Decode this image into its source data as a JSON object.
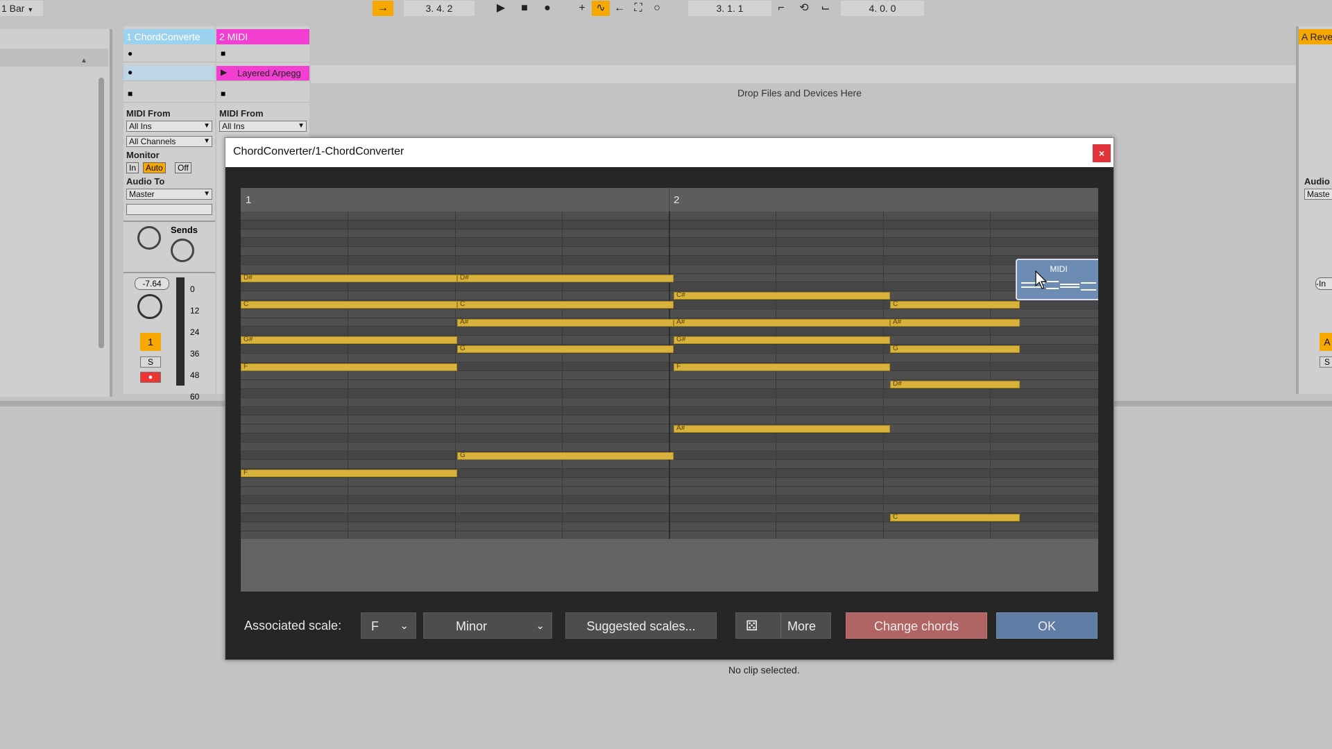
{
  "topbar": {
    "quantize": "1 Bar",
    "position": "3.  4.  2",
    "loop_start": "3.  1.  1",
    "loop_length": "4.  0.  0"
  },
  "tracks": [
    {
      "name": "1 ChordConverte",
      "color": "#9bd3ef"
    },
    {
      "name": "2 MIDI",
      "color": "#f23fd2"
    }
  ],
  "return_track": {
    "name": "A Reve",
    "color": "#f7a800"
  },
  "session": {
    "drop_text": "Drop Files and Devices Here",
    "clip_name": "Layered Arpegg",
    "midi_from_label": "MIDI From",
    "midi_from_value": "All Ins",
    "channel_value": "All Channels",
    "monitor_label": "Monitor",
    "monitor_in": "In",
    "monitor_auto": "Auto",
    "monitor_off": "Off",
    "audio_to_label": "Audio To",
    "audio_to_value": "Master",
    "sends_label": "Sends",
    "volume_value": "-7.64",
    "meter_ticks": [
      "0",
      "12",
      "24",
      "36",
      "48",
      "60"
    ],
    "track_number": "1",
    "solo": "S",
    "return_audio_label": "Audio",
    "return_master": "Maste",
    "return_in": "-In",
    "return_letter": "A",
    "return_solo": "S",
    "status": "No clip selected."
  },
  "dialog": {
    "title": "ChordConverter/1-ChordConverter",
    "close_label": "×",
    "bar_numbers": [
      "1",
      "2"
    ],
    "midi_card_label": "MIDI",
    "assoc_scale_label": "Associated scale:",
    "scale_root": "F",
    "scale_type": "Minor",
    "suggested_label": "Suggested scales...",
    "more_label": "More",
    "change_chords_label": "Change chords",
    "ok_label": "OK"
  },
  "notes": [
    {
      "pitch": "D#",
      "row": 7,
      "start": 0,
      "end": 2
    },
    {
      "pitch": "C",
      "row": 10,
      "start": 0,
      "end": 2
    },
    {
      "pitch": "G#",
      "row": 14,
      "start": 0,
      "end": 2
    },
    {
      "pitch": "F",
      "row": 17,
      "start": 0,
      "end": 2
    },
    {
      "pitch": "F",
      "row": 29,
      "start": 0,
      "end": 2
    },
    {
      "pitch": "D#",
      "row": 7,
      "start": 2,
      "end": 4
    },
    {
      "pitch": "C",
      "row": 10,
      "start": 2,
      "end": 4
    },
    {
      "pitch": "A#",
      "row": 12,
      "start": 2,
      "end": 4
    },
    {
      "pitch": "G",
      "row": 15,
      "start": 2,
      "end": 4
    },
    {
      "pitch": "G",
      "row": 27,
      "start": 2,
      "end": 4
    },
    {
      "pitch": "C#",
      "row": 9,
      "start": 4,
      "end": 6
    },
    {
      "pitch": "A#",
      "row": 12,
      "start": 4,
      "end": 6
    },
    {
      "pitch": "G#",
      "row": 14,
      "start": 4,
      "end": 6
    },
    {
      "pitch": "F",
      "row": 17,
      "start": 4,
      "end": 6
    },
    {
      "pitch": "A#",
      "row": 24,
      "start": 4,
      "end": 6
    },
    {
      "pitch": "C",
      "row": 10,
      "start": 6,
      "end": 7.2
    },
    {
      "pitch": "A#",
      "row": 12,
      "start": 6,
      "end": 7.2
    },
    {
      "pitch": "G",
      "row": 15,
      "start": 6,
      "end": 7.2
    },
    {
      "pitch": "D#",
      "row": 19,
      "start": 6,
      "end": 7.2
    },
    {
      "pitch": "C",
      "row": 34,
      "start": 6,
      "end": 7.2
    }
  ]
}
